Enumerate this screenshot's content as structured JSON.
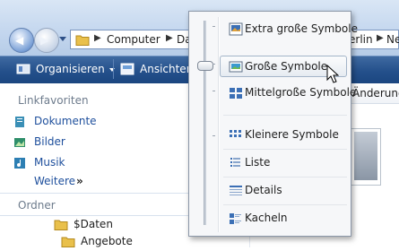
{
  "address_bar": {
    "crumbs": [
      "Computer",
      "Da",
      "erlin",
      "Ne"
    ]
  },
  "toolbar": {
    "organize_label": "Organisieren",
    "views_label": "Ansichten"
  },
  "nav_pane": {
    "favorites_title": "Linkfavoriten",
    "favorites": [
      {
        "label": "Dokumente",
        "icon": "documents-icon"
      },
      {
        "label": "Bilder",
        "icon": "pictures-icon"
      },
      {
        "label": "Musik",
        "icon": "music-icon"
      }
    ],
    "more_label": "Weitere",
    "more_chevron": "»",
    "folders_title": "Ordner",
    "tree": [
      {
        "label": "$Daten"
      },
      {
        "label": "Angebote"
      }
    ]
  },
  "content": {
    "column_header": "Änderung"
  },
  "view_menu": {
    "items": [
      {
        "label": "Extra große Symbole",
        "icon": "extra-large-icons-icon"
      },
      {
        "label": "Große Symbole",
        "icon": "large-icons-icon",
        "highlighted": true
      },
      {
        "label": "Mittelgroße Symbole",
        "icon": "medium-icons-icon"
      },
      {
        "label": "Kleinere Symbole",
        "icon": "small-icons-icon"
      },
      {
        "label": "Liste",
        "icon": "list-icon"
      },
      {
        "label": "Details",
        "icon": "details-icon"
      },
      {
        "label": "Kacheln",
        "icon": "tiles-icon"
      }
    ]
  },
  "colors": {
    "toolbar": "#24508b",
    "link": "#1e4f9c",
    "section_title": "#6d7b8c"
  }
}
